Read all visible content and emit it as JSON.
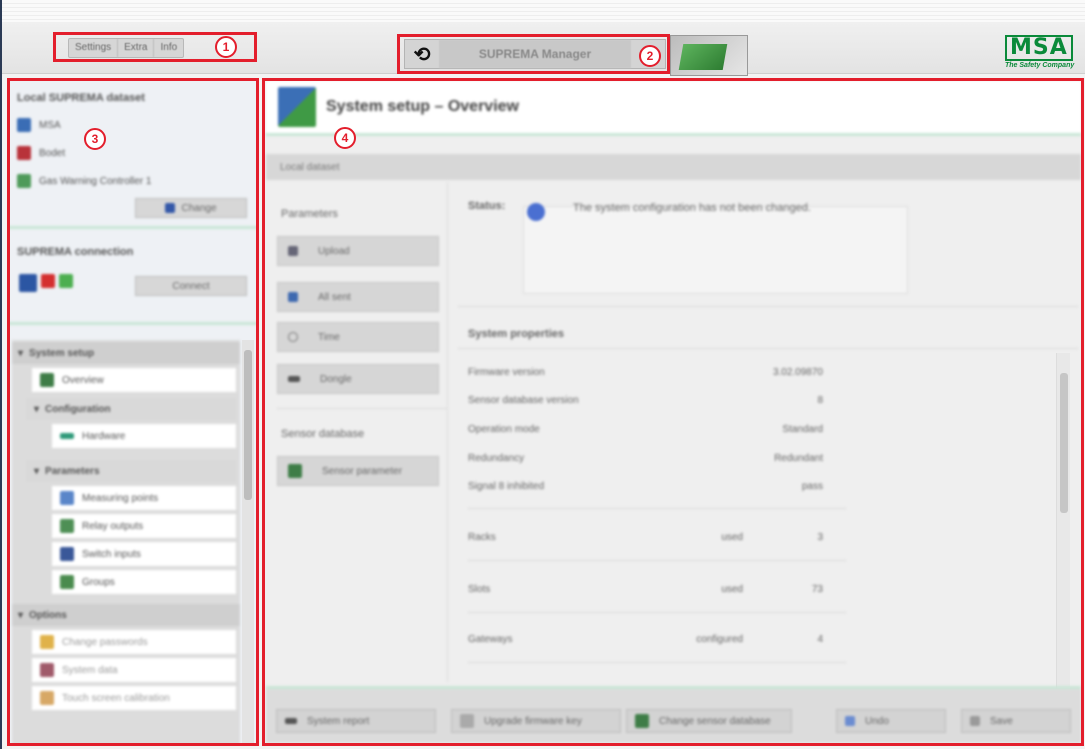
{
  "menu": {
    "items": [
      "Settings",
      "Extra",
      "Info"
    ]
  },
  "manager": {
    "title": "SUPREMA Manager"
  },
  "logo": {
    "word": "MSA",
    "tagline": "The Safety Company"
  },
  "callouts": [
    "1",
    "2",
    "3",
    "4"
  ],
  "left_panel": {
    "dataset_title": "Local SUPREMA dataset",
    "dataset_items": [
      {
        "label": "MSA",
        "icon": "user-icon"
      },
      {
        "label": "Bodet",
        "icon": "building-icon"
      },
      {
        "label": "Gas Warning Controller 1",
        "icon": "controller-icon"
      }
    ],
    "change_button": "Change",
    "connection_title": "SUPREMA connection",
    "connect_button": "Connect",
    "tree": {
      "system_setup": "System setup",
      "overview": "Overview",
      "configuration": "Configuration",
      "hardware": "Hardware",
      "parameters": "Parameters",
      "measuring_points": "Measuring points",
      "relay_outputs": "Relay outputs",
      "switch_inputs": "Switch inputs",
      "groups": "Groups",
      "options": "Options",
      "change_passwords": "Change passwords",
      "system_data": "System data",
      "touch_screen_calibration": "Touch screen calibration"
    }
  },
  "right_panel": {
    "title": "System setup – Overview",
    "subbar": "Local dataset",
    "parameters_label": "Parameters",
    "param_buttons": [
      "Upload",
      "All sent",
      "Time",
      "Dongle"
    ],
    "sensor_db_label": "Sensor database",
    "sensor_button": "Sensor parameter",
    "status_label": "Status:",
    "status_text": "The system configuration has not been changed.",
    "system_properties_title": "System properties",
    "properties": [
      {
        "key": "Firmware version",
        "unit": "",
        "value": "3.02.09870"
      },
      {
        "key": "Sensor database version",
        "unit": "",
        "value": "8"
      },
      {
        "key": "Operation mode",
        "unit": "",
        "value": "Standard"
      },
      {
        "key": "Redundancy",
        "unit": "",
        "value": "Redundant"
      },
      {
        "key": "Signal 8 inhibited",
        "unit": "",
        "value": "pass"
      }
    ],
    "counts": [
      {
        "key": "Racks",
        "unit": "used",
        "value": "3"
      },
      {
        "key": "Slots",
        "unit": "used",
        "value": "73"
      },
      {
        "key": "Gateways",
        "unit": "configured",
        "value": "4"
      }
    ],
    "footer_buttons": [
      "System report",
      "Upgrade firmware key",
      "Change sensor database",
      "Undo",
      "Save"
    ]
  }
}
